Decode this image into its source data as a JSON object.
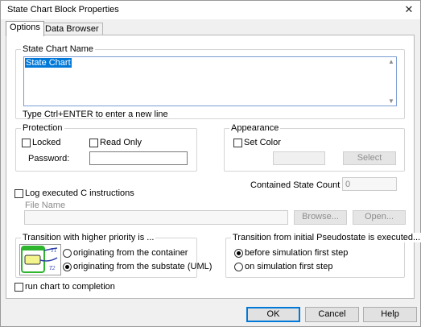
{
  "window": {
    "title": "State Chart Block Properties",
    "close_glyph": "✕"
  },
  "tabs": [
    {
      "label": "Options"
    },
    {
      "label": "Data Browser"
    }
  ],
  "name_group": {
    "title": "State Chart Name",
    "value": "State Chart",
    "hint": "Type Ctrl+ENTER to enter a new line"
  },
  "protection": {
    "title": "Protection",
    "locked_label": "Locked",
    "readonly_label": "Read Only",
    "password_label": "Password:",
    "password_value": ""
  },
  "appearance": {
    "title": "Appearance",
    "set_color_label": "Set Color",
    "select_label": "Select"
  },
  "contained_state_count": {
    "label": "Contained State Count",
    "value": "0"
  },
  "log": {
    "label": "Log executed C instructions",
    "file_name_label": "File Name",
    "file_name_value": "",
    "browse_label": "Browse...",
    "open_label": "Open..."
  },
  "priority": {
    "title": "Transition with higher priority is ...",
    "option_container": "originating from the container",
    "option_substate": "originating from the substate (UML)",
    "t1": "T1",
    "t2": "T2"
  },
  "pseudostate": {
    "title": "Transition from initial Pseudostate is executed...",
    "option_before": "before simulation first step",
    "option_on": "on simulation first step"
  },
  "run_to_completion": {
    "label": "run chart to completion"
  },
  "footer": {
    "ok": "OK",
    "cancel": "Cancel",
    "help": "Help"
  },
  "colors": {
    "accent": "#0078d7",
    "diagram_green": "#2db52d",
    "diagram_yellow": "#f4f48c",
    "diagram_blue": "#2b3ea8"
  },
  "icons": {
    "close": "close-icon",
    "scroll_up": "chevron-up-icon",
    "scroll_down": "chevron-down-icon"
  }
}
